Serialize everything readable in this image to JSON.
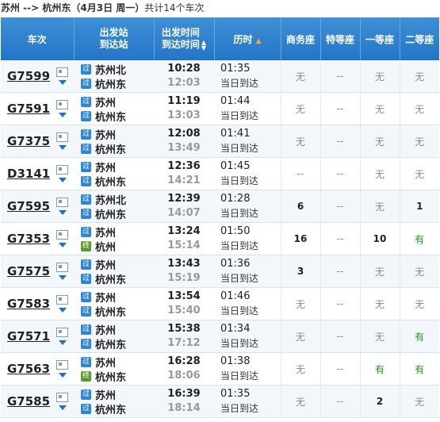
{
  "summary": {
    "route": "苏州 --> 杭州东",
    "date": "（4月3日  周一）",
    "count": "共计14个车次"
  },
  "header": {
    "train_no": "车次",
    "station_top": "出发站",
    "station_bot": "到达站",
    "time_top": "出发时间",
    "time_bot": "到达时间",
    "duration": "历时",
    "business": "商务座",
    "special": "特等座",
    "first": "一等座",
    "second": "二等座"
  },
  "rows": [
    {
      "no": "G7599",
      "from": "苏州北",
      "to": "杭州东",
      "from_tag": "过",
      "to_tag": "过",
      "dep": "10:28",
      "arr": "12:03",
      "dur": "01:35",
      "day": "当日到达",
      "business": "无",
      "special": "--",
      "first": "无",
      "second": "无"
    },
    {
      "no": "G7591",
      "from": "苏州",
      "to": "杭州东",
      "from_tag": "过",
      "to_tag": "过",
      "dep": "11:19",
      "arr": "13:03",
      "dur": "01:44",
      "day": "当日到达",
      "business": "无",
      "special": "--",
      "first": "无",
      "second": "无"
    },
    {
      "no": "G7375",
      "from": "苏州",
      "to": "杭州东",
      "from_tag": "过",
      "to_tag": "过",
      "dep": "12:08",
      "arr": "13:49",
      "dur": "01:41",
      "day": "当日到达",
      "business": "无",
      "special": "--",
      "first": "无",
      "second": "无"
    },
    {
      "no": "D3141",
      "from": "苏州",
      "to": "杭州东",
      "from_tag": "过",
      "to_tag": "过",
      "dep": "12:36",
      "arr": "14:21",
      "dur": "01:45",
      "day": "当日到达",
      "business": "--",
      "special": "--",
      "first": "无",
      "second": "无"
    },
    {
      "no": "G7595",
      "from": "苏州北",
      "to": "杭州东",
      "from_tag": "过",
      "to_tag": "过",
      "dep": "12:39",
      "arr": "14:07",
      "dur": "01:28",
      "day": "当日到达",
      "business": "6",
      "special": "--",
      "first": "无",
      "second": "1"
    },
    {
      "no": "G7353",
      "from": "苏州",
      "to": "杭州",
      "from_tag": "过",
      "to_tag": "终",
      "dep": "13:24",
      "arr": "15:14",
      "dur": "01:50",
      "day": "当日到达",
      "business": "16",
      "special": "--",
      "first": "10",
      "second": "有"
    },
    {
      "no": "G7575",
      "from": "苏州",
      "to": "杭州东",
      "from_tag": "过",
      "to_tag": "过",
      "dep": "13:43",
      "arr": "15:19",
      "dur": "01:36",
      "day": "当日到达",
      "business": "3",
      "special": "--",
      "first": "无",
      "second": "无"
    },
    {
      "no": "G7583",
      "from": "苏州",
      "to": "杭州东",
      "from_tag": "过",
      "to_tag": "过",
      "dep": "13:54",
      "arr": "15:40",
      "dur": "01:46",
      "day": "当日到达",
      "business": "无",
      "special": "--",
      "first": "无",
      "second": "无"
    },
    {
      "no": "G7571",
      "from": "苏州",
      "to": "杭州东",
      "from_tag": "过",
      "to_tag": "过",
      "dep": "15:38",
      "arr": "17:12",
      "dur": "01:34",
      "day": "当日到达",
      "business": "无",
      "special": "--",
      "first": "无",
      "second": "有"
    },
    {
      "no": "G7563",
      "from": "苏州",
      "to": "杭州东",
      "from_tag": "过",
      "to_tag": "终",
      "dep": "16:28",
      "arr": "18:06",
      "dur": "01:38",
      "day": "当日到达",
      "business": "无",
      "special": "--",
      "first": "有",
      "second": "有"
    },
    {
      "no": "G7585",
      "from": "苏州",
      "to": "杭州东",
      "from_tag": "过",
      "to_tag": "过",
      "dep": "16:39",
      "arr": "18:14",
      "dur": "01:35",
      "day": "当日到达",
      "business": "无",
      "special": "--",
      "first": "2",
      "second": "无"
    }
  ],
  "colors": {
    "header_bg": "#2e80cf",
    "accent": "#f5a43b",
    "available": "#2b8a2b"
  }
}
